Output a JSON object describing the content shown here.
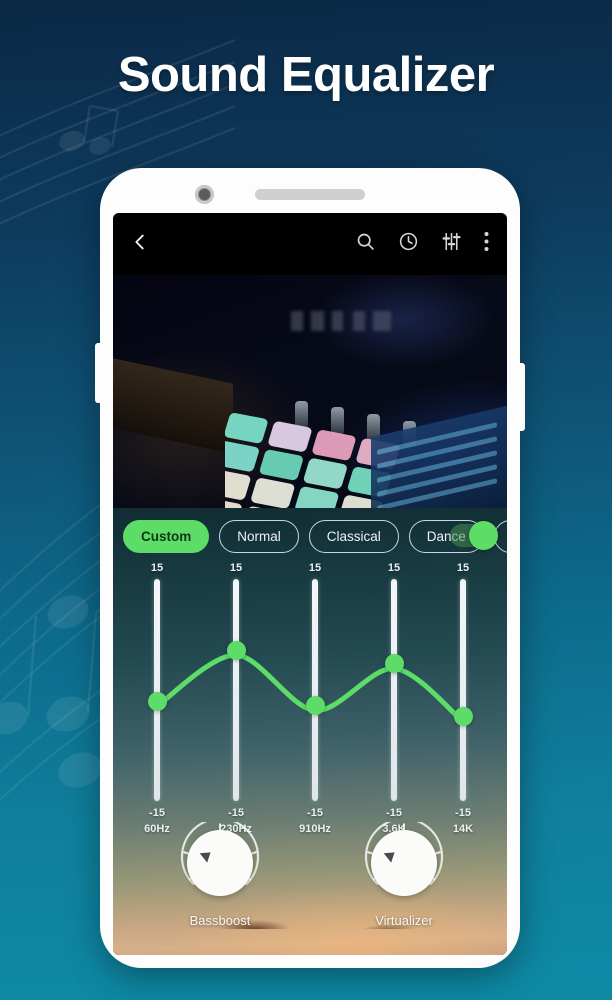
{
  "headline": "Sound Equalizer",
  "theme": {
    "bg_top": "#0b2844",
    "bg_bottom": "#0e8aa5",
    "accent_green": "#5ddc67",
    "panel_top": "#102d33",
    "panel_bottom": "#c9a07e"
  },
  "phone": {
    "topbar": {
      "back_icon": "chevron-left-icon",
      "icons": [
        "search-icon",
        "clock-icon",
        "equalizer-icon",
        "overflow-menu-icon"
      ]
    },
    "album_art": {
      "description": "drum-pad-controller"
    },
    "presets": [
      {
        "label": "Custom",
        "active": true
      },
      {
        "label": "Normal",
        "active": false
      },
      {
        "label": "Classical",
        "active": false
      },
      {
        "label": "Dance",
        "active": false
      },
      {
        "label": "",
        "active": false
      }
    ],
    "power_switch": {
      "state": "on"
    },
    "equalizer": {
      "max_label": "15",
      "min_label": "-15",
      "bands": [
        {
          "freq": "60Hz",
          "max": "15",
          "min": "-15",
          "value": 0.45
        },
        {
          "freq": "230Hz",
          "max": "15",
          "min": "-15",
          "value": 0.68
        },
        {
          "freq": "910Hz",
          "max": "15",
          "min": "-15",
          "value": 0.43
        },
        {
          "freq": "3.6K",
          "max": "15",
          "min": "-15",
          "value": 0.62
        },
        {
          "freq": "14K",
          "max": "15",
          "min": "-15",
          "value": 0.38
        }
      ]
    },
    "knobs": [
      {
        "label": "Bassboost",
        "angle": -38
      },
      {
        "label": "Virtualizer",
        "angle": -38
      }
    ]
  }
}
